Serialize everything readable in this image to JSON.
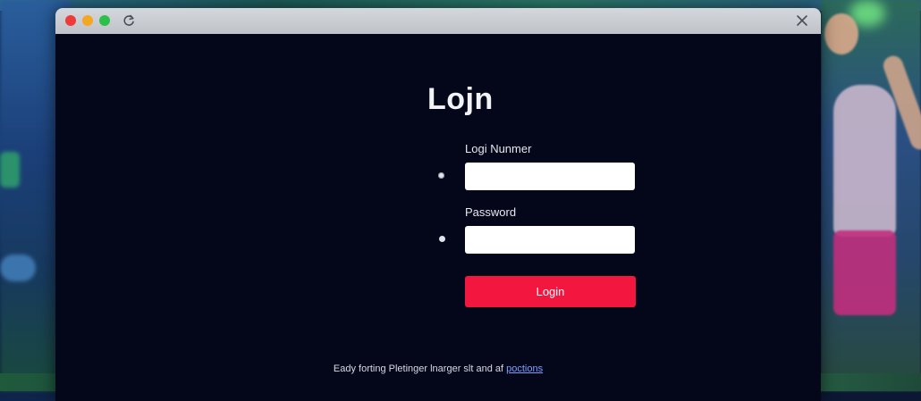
{
  "window": {
    "controls": [
      "close",
      "minimize",
      "maximize"
    ],
    "reload_icon": "reload-icon",
    "close_icon": "close-icon"
  },
  "login": {
    "title": "Lojn",
    "field1_label": "Logi Nunmer",
    "field1_value": "",
    "field2_label": "Password",
    "field2_value": "",
    "button_label": "Login",
    "button_color": "#f3173f"
  },
  "footer": {
    "text": "Eady forting Pletinger lnarger slt and af",
    "link_text": "poctions"
  },
  "colors": {
    "background": "#04061a",
    "accent": "#f3173f",
    "link": "#7aa3ff"
  }
}
